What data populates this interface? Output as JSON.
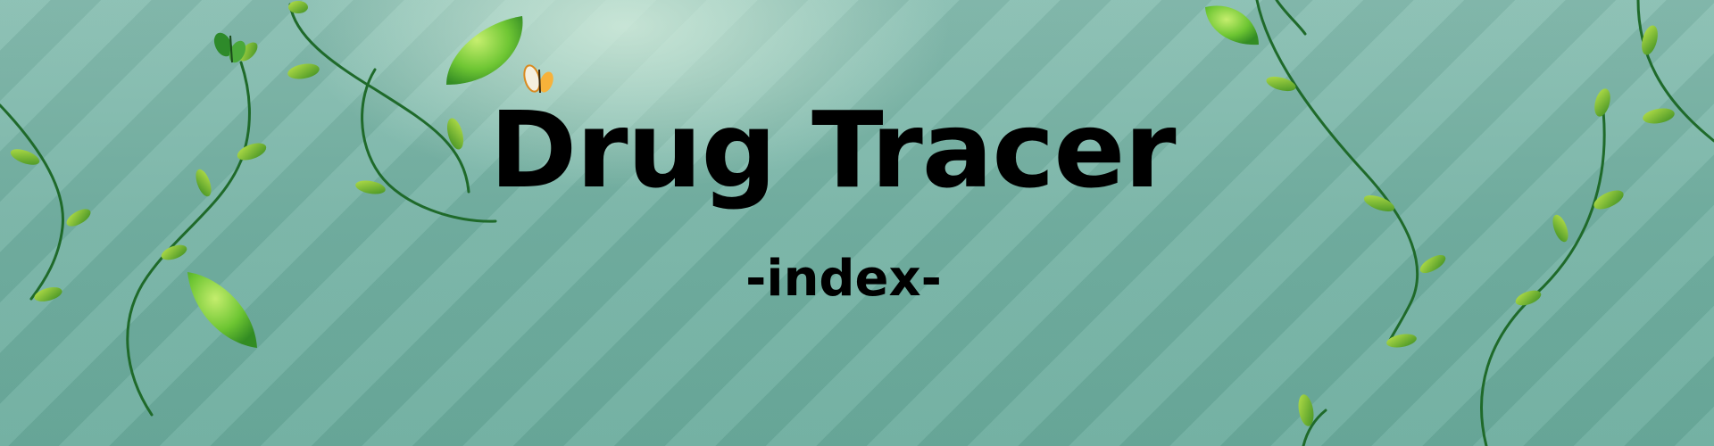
{
  "header": {
    "title": "Drug Tracer",
    "subtitle": "-index-"
  },
  "decor": {
    "vine_icon": "vine-icon",
    "leaf_icon": "leaf-icon",
    "butterfly_icon": "butterfly-icon"
  },
  "colors": {
    "background": "#75b2a4",
    "highlight": "#cfe8da",
    "vine": "#1f6a2a",
    "leaf": "#5fbf2a",
    "leaf_dark": "#2f7f1f",
    "text": "#000000"
  }
}
